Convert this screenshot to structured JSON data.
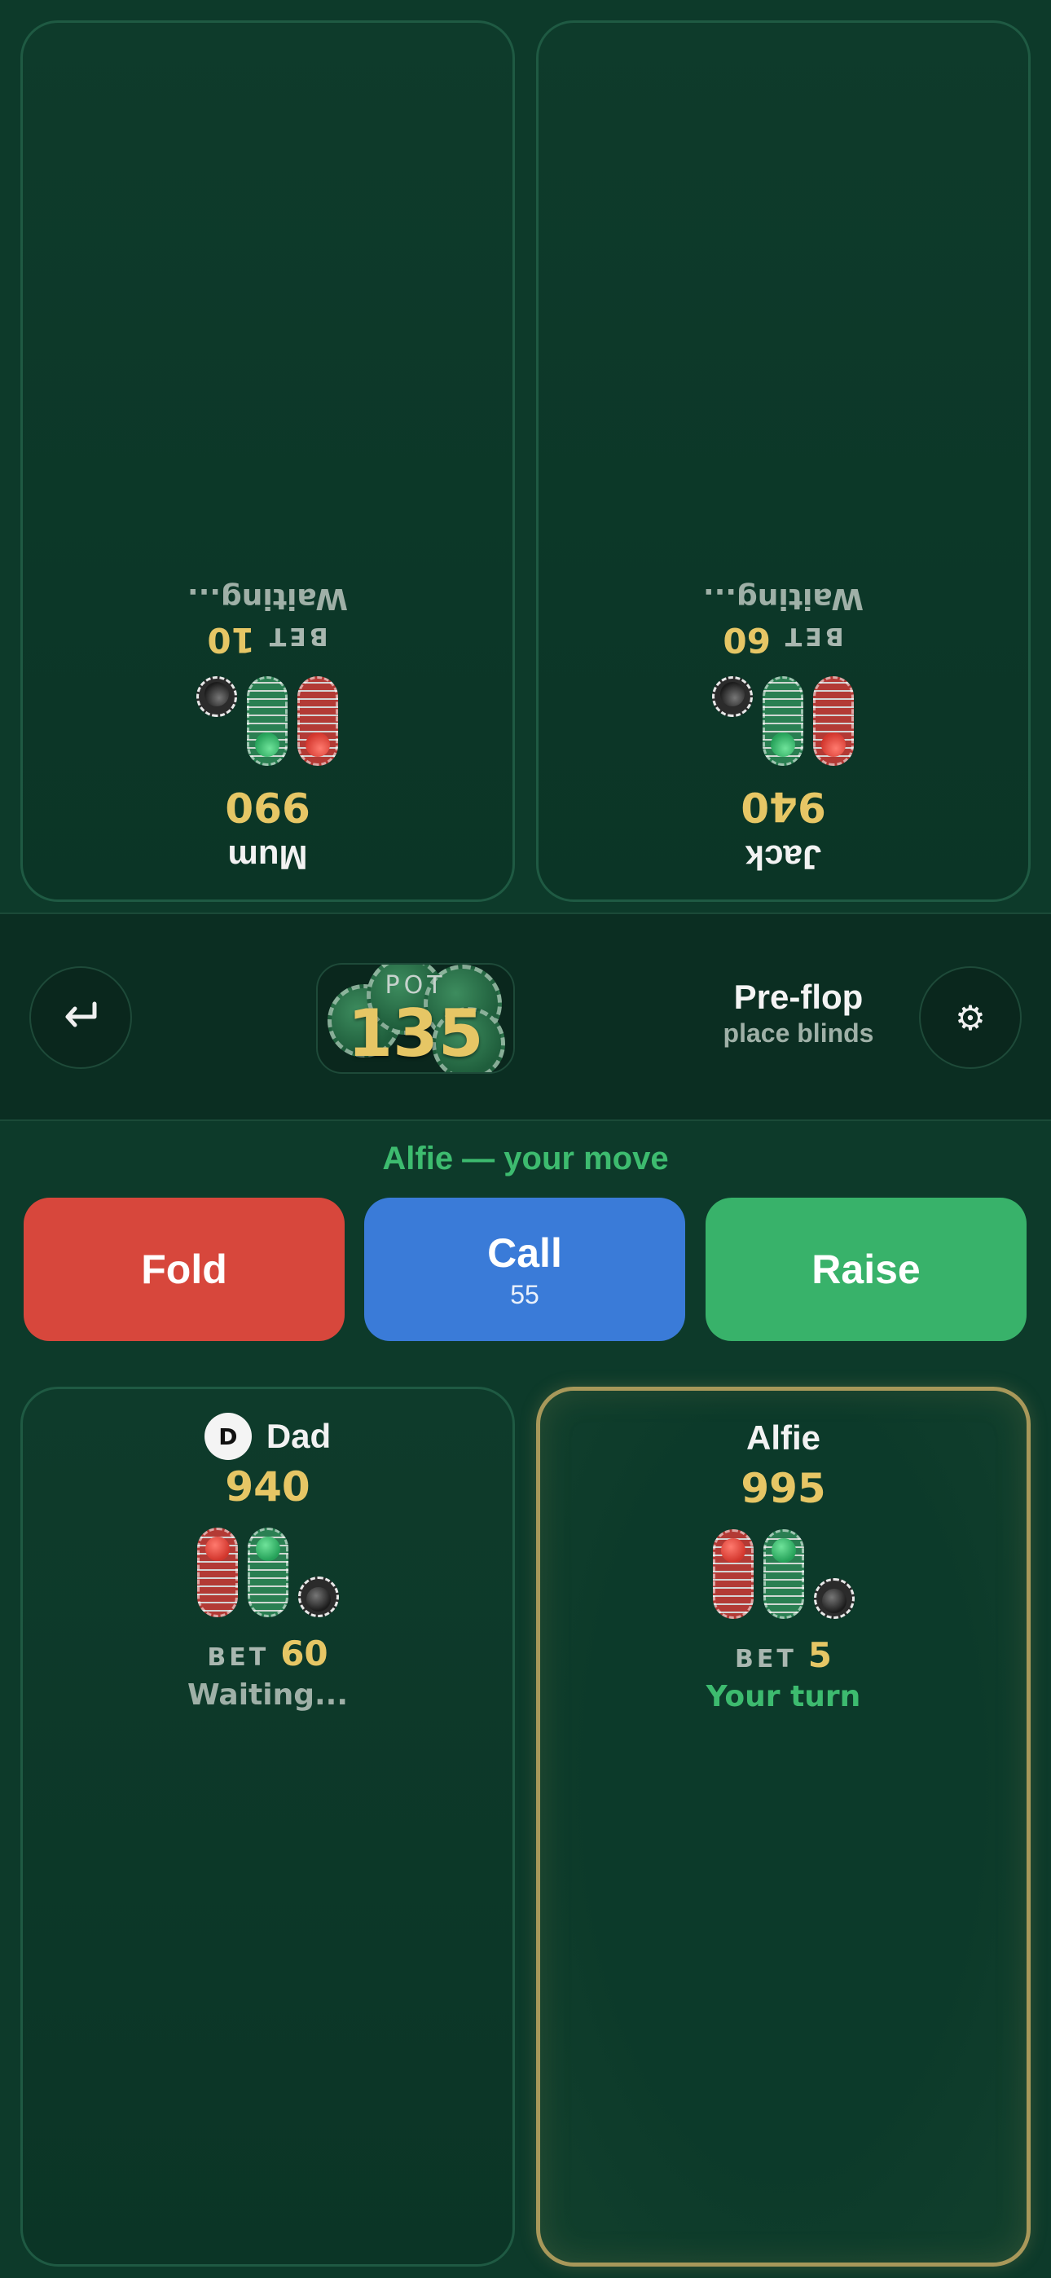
{
  "players": {
    "mum": {
      "name": "Mum",
      "stack": "990",
      "bet_label": "BET",
      "bet": "10",
      "status": "Waiting..."
    },
    "jack": {
      "name": "Jack",
      "stack": "940",
      "bet_label": "BET",
      "bet": "60",
      "status": "Waiting..."
    },
    "dad": {
      "dealer_badge": "D",
      "name": "Dad",
      "stack": "940",
      "bet_label": "BET",
      "bet": "60",
      "status": "Waiting..."
    },
    "alfie": {
      "name": "Alfie",
      "stack": "995",
      "bet_label": "BET",
      "bet": "5",
      "status": "Your turn"
    }
  },
  "table": {
    "back_icon": "return-arrow-icon",
    "settings_icon": "gear-icon",
    "pot_label": "POT",
    "pot_value": "135",
    "phase": "Pre-flop",
    "phase_hint": "place blinds"
  },
  "actions": {
    "prompt": "Alfie — your move",
    "fold": "Fold",
    "call": "Call",
    "call_amount": "55",
    "raise": "Raise"
  },
  "colors": {
    "felt": "#0d3a2a",
    "gold": "#e6c665",
    "fold": "#d7473c",
    "call": "#3a7bd8",
    "raise": "#38b26a",
    "turn_green": "#3dbb6f"
  }
}
